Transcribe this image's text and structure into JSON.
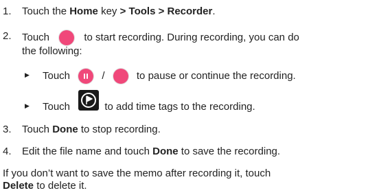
{
  "steps": [
    {
      "num": "1.",
      "t1": "Touch the ",
      "b1": "Home",
      "t2": " key ",
      "b2": "> Tools > Recorder",
      "t3": "."
    },
    {
      "num": "2.",
      "t1": "Touch",
      "t2": "to start recording. During recording, you can do",
      "t3": "the following:"
    },
    {
      "sub1": {
        "bullet": "▶",
        "t1": "Touch",
        "sep": "/",
        "t2": "to pause or continue the recording."
      },
      "sub2": {
        "bullet": "▶",
        "t1": "Touch",
        "t2": "to add time tags to the recording."
      }
    },
    {
      "num": "3.",
      "t1": "Touch ",
      "b1": "Done",
      "t2": " to stop recording."
    },
    {
      "num": "4.",
      "t1": "Edit the file name and touch ",
      "b1": "Done",
      "t2": " to save the recording."
    }
  ],
  "footer": {
    "t1": "If you don’t want to save the memo after recording it, touch",
    "b1": "Delete",
    "t2": " to delete it."
  },
  "icons": {
    "record": "record-button-icon",
    "pause": "pause-button-icon",
    "time_tag": "time-tag-button-icon",
    "record_color": "#f0487a"
  }
}
